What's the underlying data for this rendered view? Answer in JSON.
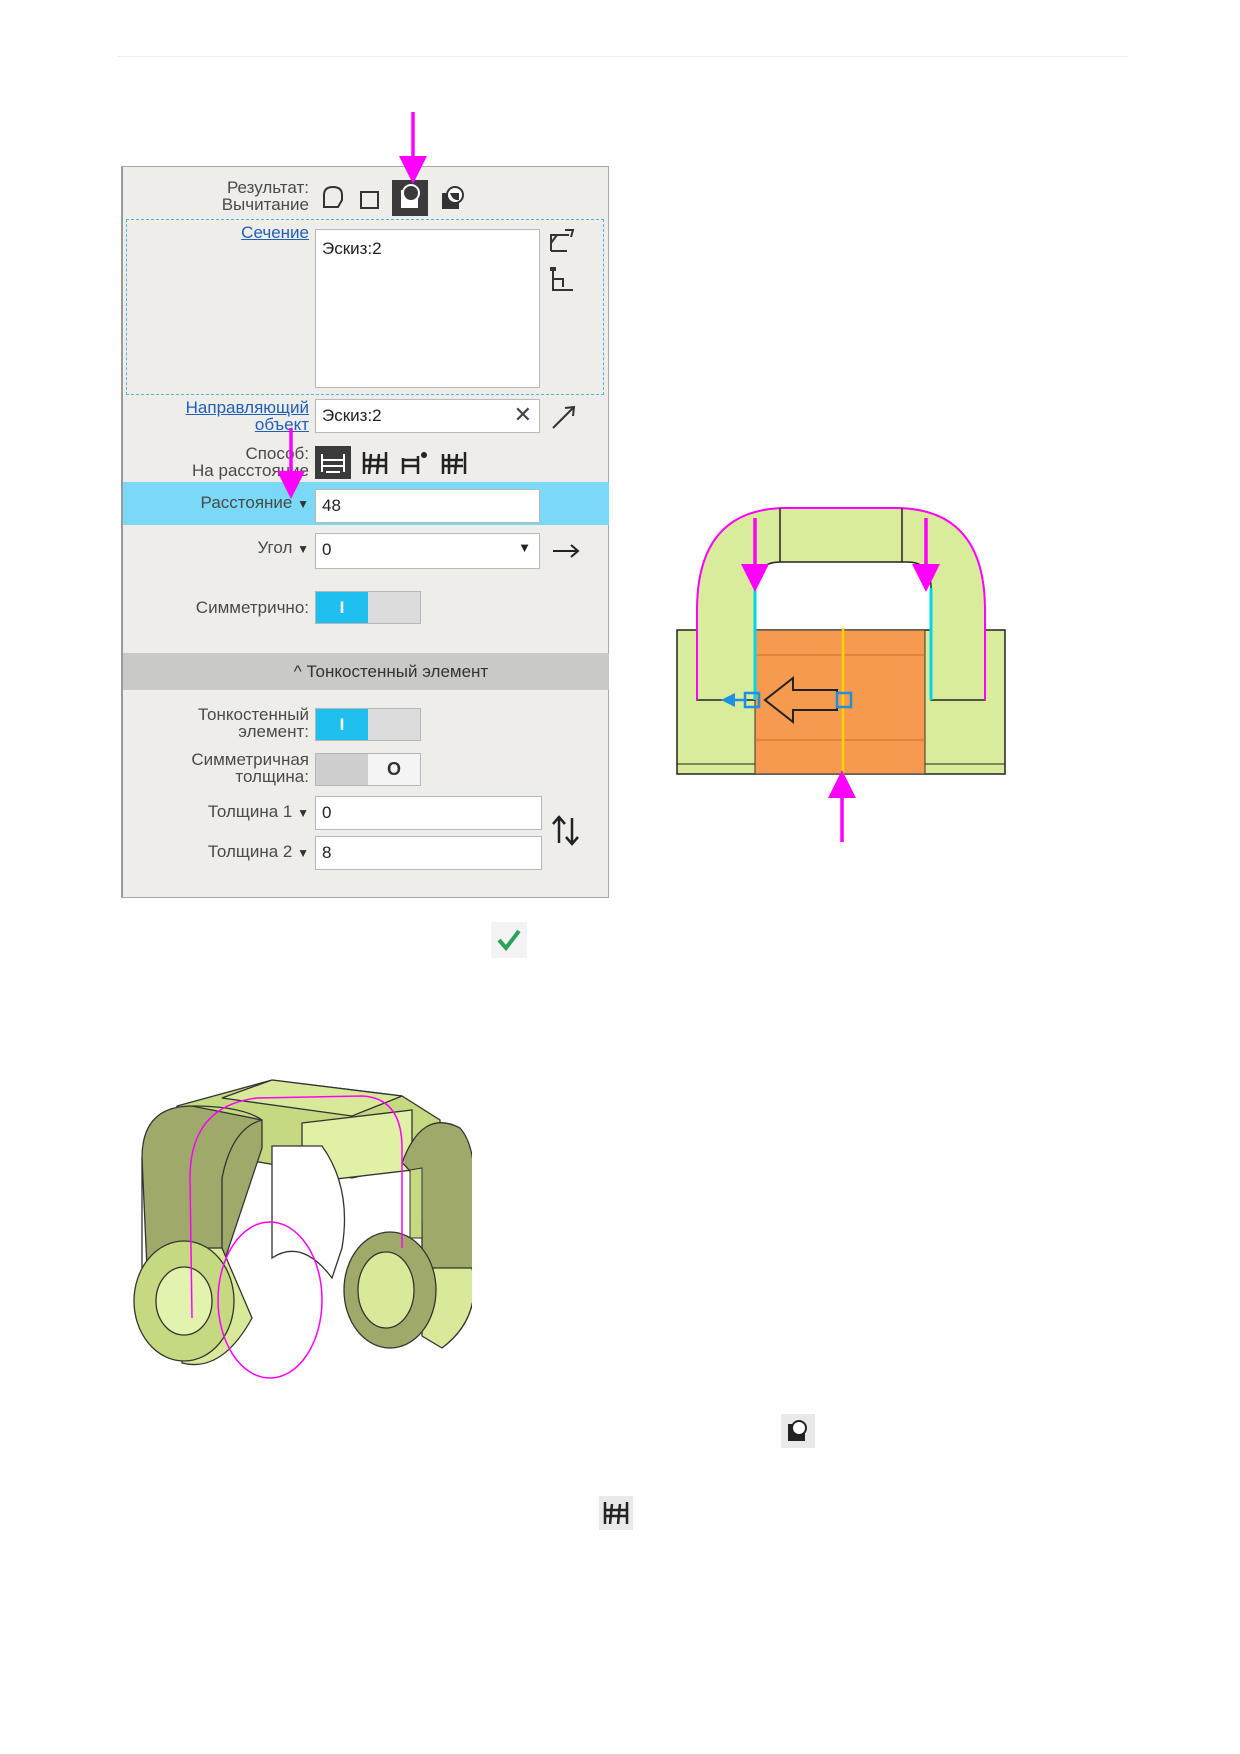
{
  "panel": {
    "result_label": "Результат:",
    "result_value": "Вычитание",
    "section_label": "Сечение",
    "section_value": "Эскиз:2",
    "guide_label_1": "Направляющий",
    "guide_label_2": "объект",
    "guide_value": "Эскиз:2",
    "method_label": "Способ:",
    "method_value": "На расстояние",
    "distance_label": "Расстояние",
    "distance_value": "48",
    "angle_label": "Угол",
    "angle_value": "0",
    "symmetric_label": "Симметрично:",
    "symmetric_on": "I",
    "thin_group_title": "Тонкостенный элемент",
    "thin_label_1": "Тонкостенный",
    "thin_label_2": "элемент:",
    "thin_on": "I",
    "sym_thick_label_1": "Симметричная",
    "sym_thick_label_2": "толщина:",
    "sym_thick_off": "O",
    "thickness1_label": "Толщина 1",
    "thickness1_value": "0",
    "thickness2_label": "Толщина 2",
    "thickness2_value": "8"
  },
  "icons": [
    "shape-icon",
    "box-icon",
    "subtract-icon",
    "intersect-icon",
    "sketch-select-icon",
    "sketch-edit-icon",
    "direction-arrow-icon",
    "to-distance-icon",
    "through-all-icon",
    "to-vertex-icon",
    "to-surface-icon",
    "reverse-arrow-icon",
    "swap-thickness-icon",
    "checkmark-icon"
  ],
  "colors": {
    "accent_magenta": "#ff00ff",
    "toggle_on": "#1fc0f0",
    "highlight_row": "#79d9f6",
    "part_green": "#d8ea9a",
    "part_orange": "#f59a4f"
  }
}
